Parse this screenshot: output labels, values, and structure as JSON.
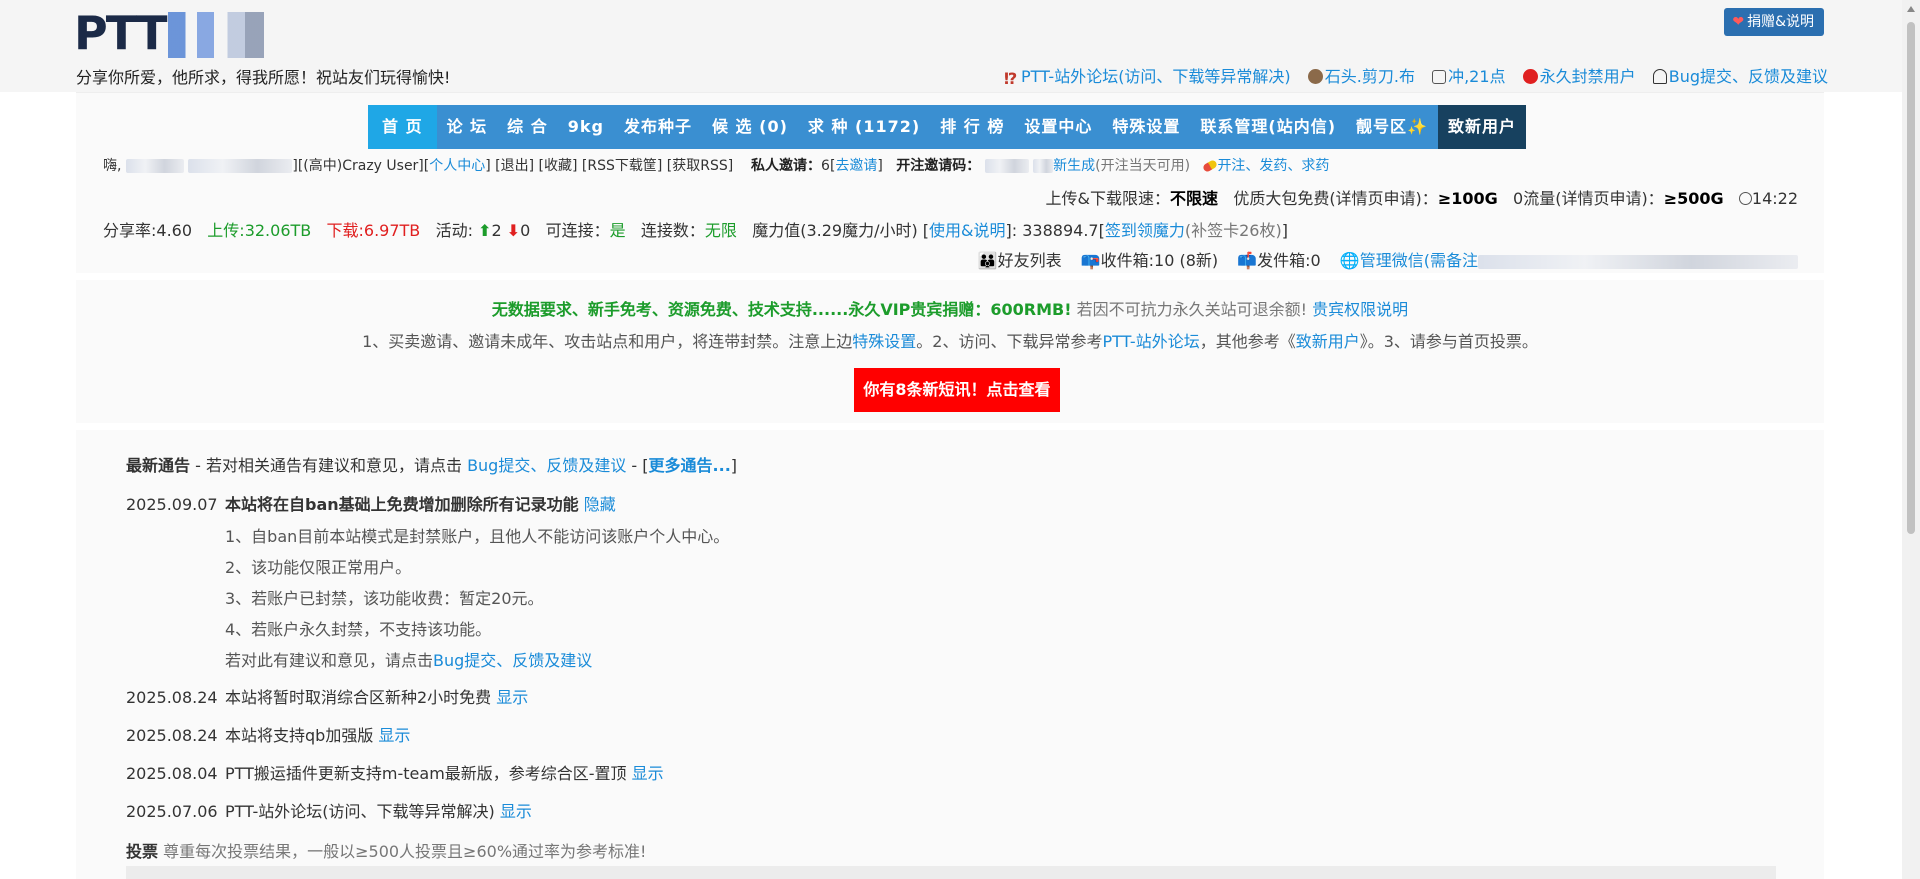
{
  "header": {
    "slogan": "分享你所爱，他所求，得我所愿！祝站友们玩得愉快!",
    "donate_label": "捐赠&说明",
    "links": [
      {
        "icon": "question-icon",
        "label": "PTT-站外论坛(访问、下载等异常解决)"
      },
      {
        "icon": "rock-icon",
        "label": "石头.剪刀.布"
      },
      {
        "icon": "dice-icon",
        "label": "冲,21点"
      },
      {
        "icon": "ban-icon",
        "label": "永久封禁用户"
      },
      {
        "icon": "ghost-icon",
        "label": "Bug提交、反馈及建议"
      }
    ]
  },
  "nav": {
    "items": [
      "首 页",
      "论 坛",
      "综 合",
      "9kg",
      "发布种子",
      "候 选 (0)",
      "求 种 (1172)",
      "排 行 榜",
      "设置中心",
      "特殊设置",
      "联系管理(站内信)",
      "靓号区✨",
      "致新用户"
    ]
  },
  "user": {
    "greeting": "嗨,",
    "class": "][(高中)Crazy User][",
    "center": "个人中心",
    "actions": "] [退出] [收藏] [RSS下载筐] [获取RSS]",
    "invite_label": "私人邀请：",
    "invite_count": "6",
    "invite_link": "去邀请",
    "open_code_label": "开注邀请码：",
    "regen": "新生成",
    "regen_note": "(开注当天可用)",
    "pill_link": "开注、发药、求药",
    "speed_label": "上传&下载限速：",
    "speed_value": "不限速",
    "pack_label": "优质大包免费(详情页申请)：",
    "pack_value": "≥100G",
    "zero_label": "0流量(详情页申请)：",
    "zero_value": "≥500G",
    "time": "14:22",
    "ratio": "分享率:4.60",
    "upload": "上传:32.06TB",
    "download": "下载:6.97TB",
    "active_label": "活动:",
    "active_up": "2",
    "active_down": "0",
    "connectable_label": "可连接：",
    "connectable": "是",
    "conn_label": "连接数：",
    "conn_value": "无限",
    "magic_label": "魔力值(3.29魔力/小时) [",
    "magic_usage": "使用&说明",
    "magic_value": "]: 338894.7[",
    "magic_signin": "签到领魔力",
    "magic_card": "(补签卡26枚)",
    "magic_end": "]",
    "friends": "好友列表",
    "inbox": "收件箱:10 (8新)",
    "outbox": "发件箱:0",
    "admin_wechat": "管理微信(需备注"
  },
  "notice": {
    "vip_bold": "无数据要求、新手免考、资源免费、技术支持......永久VIP贵宾捐赠：600RMB!",
    "vip_grey": "若因不可抗力永久关站可退余额!",
    "vip_link": "贵宾权限说明",
    "rules_a": "1、买卖邀请、邀请未成年、攻击站点和用户，将连带封禁。注意上边",
    "rules_link1": "特殊设置",
    "rules_b": "。2、访问、下载异常参考",
    "rules_link2": "PTT-站外论坛",
    "rules_c": "，其他参考《",
    "rules_link3": "致新用户",
    "rules_d": "》。3、请参与首页投票。",
    "sms": "你有8条新短讯！点击查看"
  },
  "news": {
    "title": "最新通告",
    "sub": " - 若对相关通告有建议和意见，请点击 ",
    "bug_link": "Bug提交、反馈及建议",
    "sep": " - [",
    "more": "更多通告...",
    "close": "]",
    "items": [
      {
        "date": "2025.09.07",
        "title": "本站将在自ban基础上免费增加删除所有记录功能",
        "action": "隐藏"
      },
      {
        "date": "2025.08.24",
        "title": "本站将暂时取消综合区新种2小时免费",
        "action": "显示"
      },
      {
        "date": "2025.08.24",
        "title": "本站将支持qb加强版",
        "action": "显示"
      },
      {
        "date": "2025.08.04",
        "title": "PTT搬运插件更新支持m-team最新版，参考综合区-置顶",
        "action": "显示"
      },
      {
        "date": "2025.07.06",
        "title": "PTT-站外论坛(访问、下载等异常解决)",
        "action": "显示"
      }
    ],
    "details": [
      "1、自ban目前本站模式是封禁账户，且他人不能访问该账户个人中心。",
      "2、该功能仅限正常用户。",
      "3、若账户已封禁，该功能收费：暂定20元。",
      "4、若账户永久封禁，不支持该功能。"
    ],
    "detail_last": "若对此有建议和意见，请点击",
    "detail_link": "Bug提交、反馈及建议",
    "vote_label": "投票",
    "vote_note": "尊重每次投票结果，一般以≥500人投票且≥60%通过率为参考标准!"
  }
}
